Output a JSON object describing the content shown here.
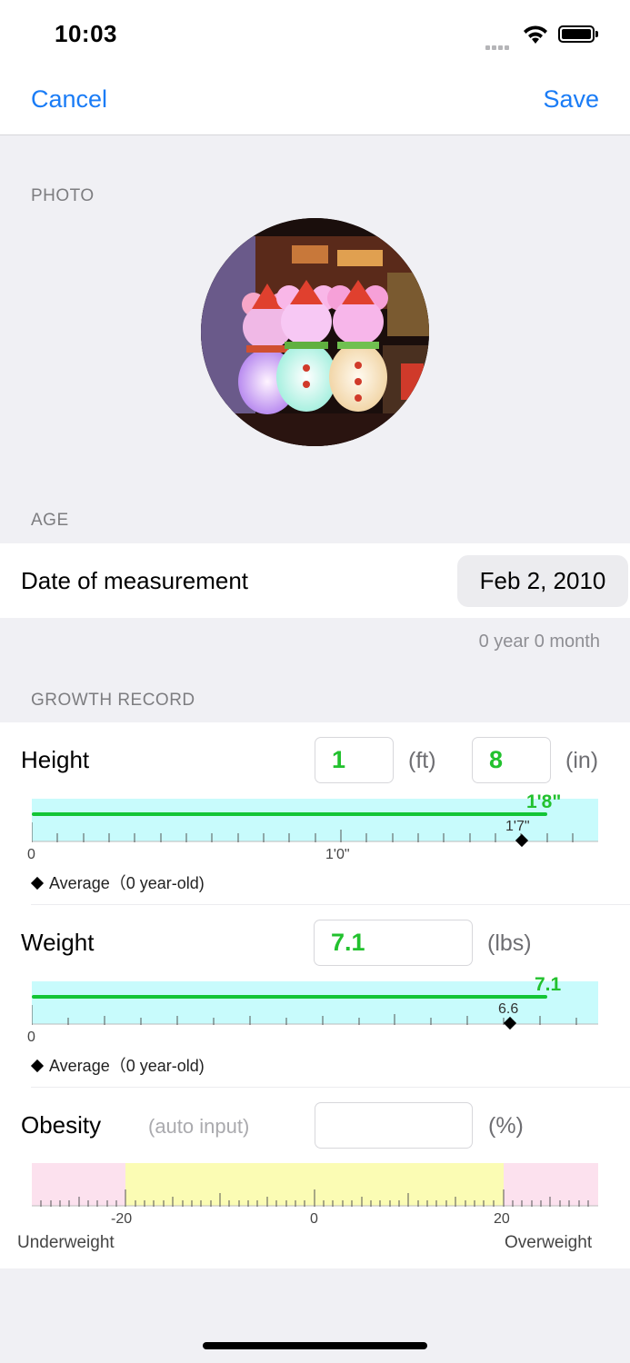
{
  "status_bar": {
    "time": "10:03"
  },
  "nav": {
    "cancel_label": "Cancel",
    "save_label": "Save"
  },
  "photo_section": {
    "header": "PHOTO"
  },
  "age_section": {
    "header": "AGE",
    "date_label": "Date of measurement",
    "date_value": "Feb 2, 2010",
    "age_text": "0 year  0 month"
  },
  "growth_section": {
    "header": "GROWTH RECORD",
    "height": {
      "label": "Height",
      "feet_value": "1",
      "feet_unit": "(ft)",
      "inch_value": "8",
      "inch_unit": "(in)",
      "scale_value_label": "1'8\"",
      "scale_average_label": "1'7\"",
      "tick_zero": "0",
      "tick_mid": "1'0\"",
      "legend": "Average（0 year-old)",
      "value_fraction": 0.91,
      "average_fraction": 0.865
    },
    "weight": {
      "label": "Weight",
      "value": "7.1",
      "unit": "(lbs)",
      "scale_value_label": "7.1",
      "scale_average_label": "6.6",
      "tick_zero": "0",
      "legend": "Average（0 year-old)",
      "value_fraction": 0.91,
      "average_fraction": 0.845
    },
    "obesity": {
      "label": "Obesity",
      "placeholder": "(auto input)",
      "value": "",
      "unit": "(%)",
      "tick_left": "-20",
      "tick_center": "0",
      "tick_right": "20",
      "left_caption": "Underweight",
      "right_caption": "Overweight"
    }
  },
  "colors": {
    "accent": "#1a7cf6",
    "value_green": "#22c12e",
    "scale_cyan": "#c8fbfc",
    "underweight_pink": "#fce1ee",
    "normal_yellow": "#fbfcb4",
    "overweight_pink": "#fce1ee"
  }
}
